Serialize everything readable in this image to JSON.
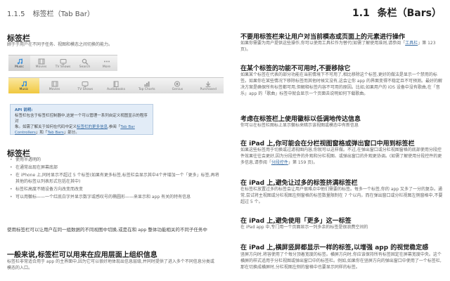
{
  "header": {
    "section_number": "1.1.5",
    "section_title": "标签栏（Tab Bar）",
    "chapter_number": "1.1",
    "chapter_title": "条栏（Bars）"
  },
  "left": {
    "tab_bar_heading": "标签栏",
    "tab_bar_intro": "顾于于用户在不同子任务、视图和模态之间切换的能力。",
    "tabbar_iphone": [
      {
        "label": "Music",
        "icon": "music-note-icon",
        "selected": true
      },
      {
        "label": "Movies",
        "icon": "film-icon",
        "selected": false
      },
      {
        "label": "TV Shows",
        "icon": "tv-icon",
        "selected": false
      },
      {
        "label": "Search",
        "icon": "search-icon",
        "selected": false
      },
      {
        "label": "More",
        "icon": "more-icon",
        "selected": false
      }
    ],
    "tabbar_ipad": [
      {
        "label": "Music",
        "icon": "music-note-icon",
        "selected": true
      },
      {
        "label": "Movies",
        "icon": "film-icon",
        "selected": false
      },
      {
        "label": "TV Shows",
        "icon": "tv-icon",
        "selected": false
      },
      {
        "label": "Audiobooks",
        "icon": "book-icon",
        "selected": false
      },
      {
        "label": "Top Charts",
        "icon": "chart-icon",
        "selected": false
      },
      {
        "label": "Genius",
        "icon": "genius-icon",
        "selected": false
      },
      {
        "label": "Purchased",
        "icon": "download-icon",
        "selected": false
      }
    ],
    "api_note": {
      "title": "API 说明:",
      "line1": "标签栏包含于标签栏控制器中,这是一个可以管理一系列自定义视图显示的程序对",
      "line2a": "象。如需了解关于如何在代码中定义",
      "link1": "标签栏的更多信息",
      "line2b": ",参阅「",
      "link2": "Tab Bar Controllers",
      "line3a": "」和「",
      "link3": "Tab Bars",
      "line3b": "」部分。"
    },
    "features_heading": "标签栏",
    "bullets": [
      "使用半透明的",
      "在通常出现在屏幕底部",
      "在 iPhone 上,同时显示不超过 5 个标签(如果有更多标签,标签栏会显示其中4个并增加一个「更多」标签,再将其他的标签以列表形式包括在其中)",
      "标签栏高度不随设备方向改变而改变",
      "可以用徽标——一个红底白字并显示数字或感叹号的椭圆形——来显示和 app 有关的特有信息"
    ],
    "switch_text": "使用标签栏可以让用户在同一组数据的不同视图中切换,或是在和 app 整体功能相关的不同子任务中",
    "flat_heading": "一般来说,标签栏可以用来在应用层面上组织信息",
    "flat_text": "标签栏非常适合用于 app 的主界面中,因为它可以很好地体现出信息层级,并同时提供了进入多个不同信息分类或模态的入口。"
  },
  "right": {
    "s1_heading": "不要用标签栏来让用户对当前模态或页面上的元素进行操作",
    "s1_text_a": "如果你需要为用户提供这些操作,你可以使用工具栏作为替代(如需了解使用准则,请参阅「",
    "s1_link": "工具栏",
    "s1_text_b": "」第 123 页)。",
    "s2_heading": "在某个标签的功能不可用时,不要移除它",
    "s2_text": "如果某个标签在代表的部分功能在当前情境下不可用了,相比移除这个标签,更好的做法是显示一个禁用的标签。如果你在某些情况下移除标签而其他时候又没有,这会让你 app 的界面变得不稳定且不可预测。最好的解决方案是确保所有标签都可用,但解释标签内容不可用的原因。比如,如果用户的 iOS 设备中没有歌曲,在「音乐」app 的「歌曲」标签中就会显示一个页面去说明如何下载歌曲。",
    "s3_heading": "考虑在标签栏上使用徽标以低调地传达信息",
    "s3_text": "你可以在标签栏图标上显示徽标来暗示该视图或模态中有新信息",
    "s4_heading": "在 iPad 上,你可能会在分栏视图窗格或弹出窗口中用到标签栏",
    "s4_text_a": "如果这些标签用于切换或过滤视图内容,你就可以这样做。不过,在弹出窗口或分栏视图窗格的底部使用分段控件效果往往会更好,因为分段控件的外观和分栏视图、或弹出窗口的外观更协调。(如需了解使用分段控件的更多信息,请参阅「",
    "s4_link": "分段控件",
    "s4_text_b": "」第 159 页)。",
    "s5_heading": "在 iPad 上,避免让过多的标签挤满标签栏",
    "s5_text": "在标签栏放置过多的标签会让用户很难点中他们需要的标签。每多一个标签,你的 app 又多了一分的复杂。通常,尝试将主视图或分栏视图左侧窗格的标签数量限制在 7 个以内。而在弹出窗口或分栏视图左侧窗格中,不要超过 5 个。",
    "s6_heading": "在 iPad 上,避免使用「更多」这一标签",
    "s6_text": "在 iPad app 中,专门用一个页面显示一列多余的标签是很浪费空间的",
    "s7_heading": "在 iPad 上,横屏竖屏都显示一样的标签,以增强 app 的视觉稳定感",
    "s7_text": "竖屏方向时,将容使用了个每分顶着宽度的标签。横屏方向时,你应该保持所有标签固定在屏幕宽度中央。这个横屏的样式适用于分栏视图或弹出窗口中的标签栏。例如,如果你在竖屏方向的弹出窗口中使用了一个标签栏,那在切换成横屏时,分栏视图左侧的窗格中也要显示同样的标签。"
  }
}
